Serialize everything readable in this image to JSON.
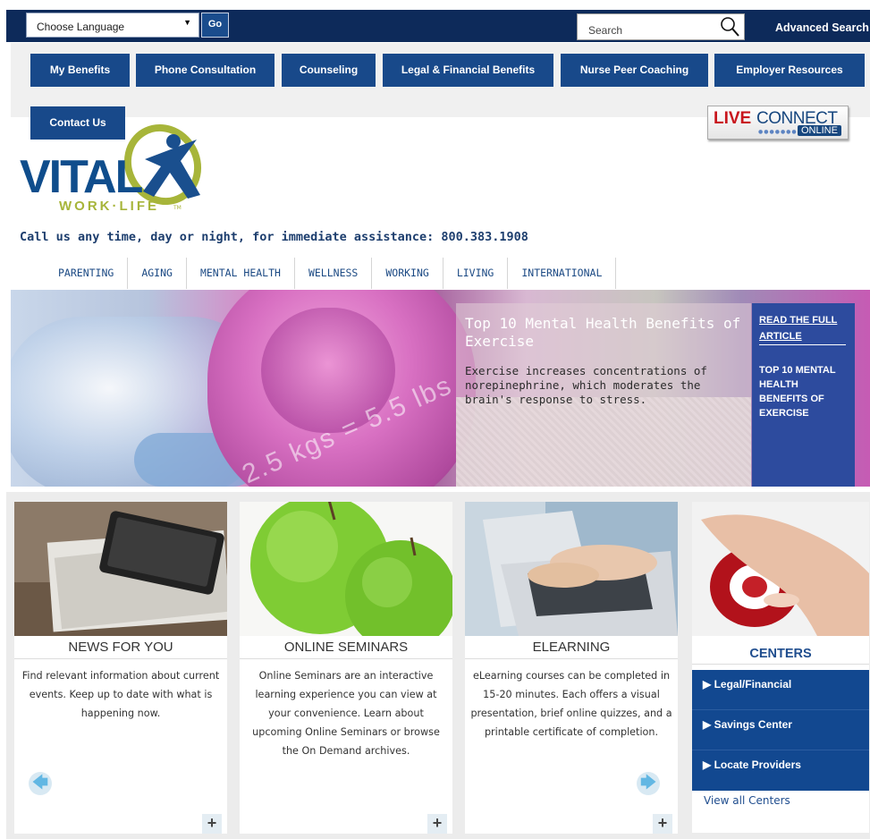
{
  "topbar": {
    "language_select": "Choose Language",
    "go_label": "Go",
    "search_placeholder": "Search",
    "advanced_search": "Advanced Search"
  },
  "nav": {
    "items": [
      {
        "label": "My Benefits"
      },
      {
        "label": "Phone Consultation"
      },
      {
        "label": "Counseling"
      },
      {
        "label": "Legal & Financial Benefits"
      },
      {
        "label": "Nurse Peer Coaching"
      },
      {
        "label": "Employer Resources"
      },
      {
        "label": "Contact Us"
      }
    ]
  },
  "liveconnect": {
    "live": "LIVE",
    "connect": "CONNECT",
    "online": "ONLINE"
  },
  "logo": {
    "vital": "VITAL",
    "worklife": "WORK·LIFE",
    "tm": "TM"
  },
  "callus": "Call us any time, day or night, for immediate assistance: 800.383.1908",
  "categories": [
    "PARENTING",
    "AGING",
    "MENTAL HEALTH",
    "WELLNESS",
    "WORKING",
    "LIVING",
    "INTERNATIONAL"
  ],
  "hero": {
    "title": "Top 10 Mental Health Benefits of Exercise",
    "description": "Exercise increases concentrations of norepinephrine, which moderates the brain's response to stress.",
    "read_full": "READ THE FULL ARTICLE",
    "side_title": "TOP 10 MENTAL HEALTH BENEFITS OF EXERCISE",
    "image_text": "2.5 kgs = 5.5 lbs"
  },
  "cards": [
    {
      "title": "NEWS FOR YOU",
      "text": "Find relevant information about current events. Keep up to date with what is happening now."
    },
    {
      "title": "ONLINE SEMINARS",
      "text": "Online Seminars are an interactive learning experience you can view at your convenience. Learn about upcoming Online Seminars or browse the On Demand archives."
    },
    {
      "title": "ELEARNING",
      "text": "eLearning courses can be completed in 15-20 minutes. Each offers a visual presentation, brief online quizzes, and a printable certificate of completion."
    }
  ],
  "centers": {
    "title": "CENTERS",
    "items": [
      {
        "label": "Legal/Financial"
      },
      {
        "label": "Savings Center"
      },
      {
        "label": "Locate Providers"
      }
    ],
    "view_all": "View all Centers"
  },
  "plus_label": "+",
  "colors": {
    "navy": "#0d2a5a",
    "nav_button": "#18498a",
    "hero_side": "#2d4b9e",
    "centers_blue": "#124890",
    "logo_green": "#a7b53a"
  }
}
